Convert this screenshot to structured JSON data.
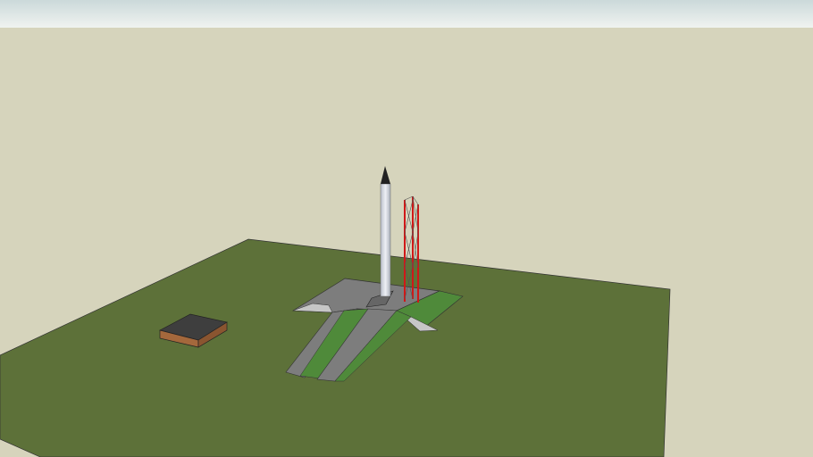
{
  "scene": {
    "colors": {
      "sky_top": "#cfdcdc",
      "sky_bottom": "#eef2ef",
      "background": "#d6d4bc",
      "ground": "#5d7139",
      "pad": "#7d7d7d",
      "grass_slope": "#4f8a3a",
      "rocket": "#dfe3ea",
      "tower": "#d01818",
      "building_roof": "#3e3e3e",
      "building_wall": "#a4683c"
    }
  }
}
